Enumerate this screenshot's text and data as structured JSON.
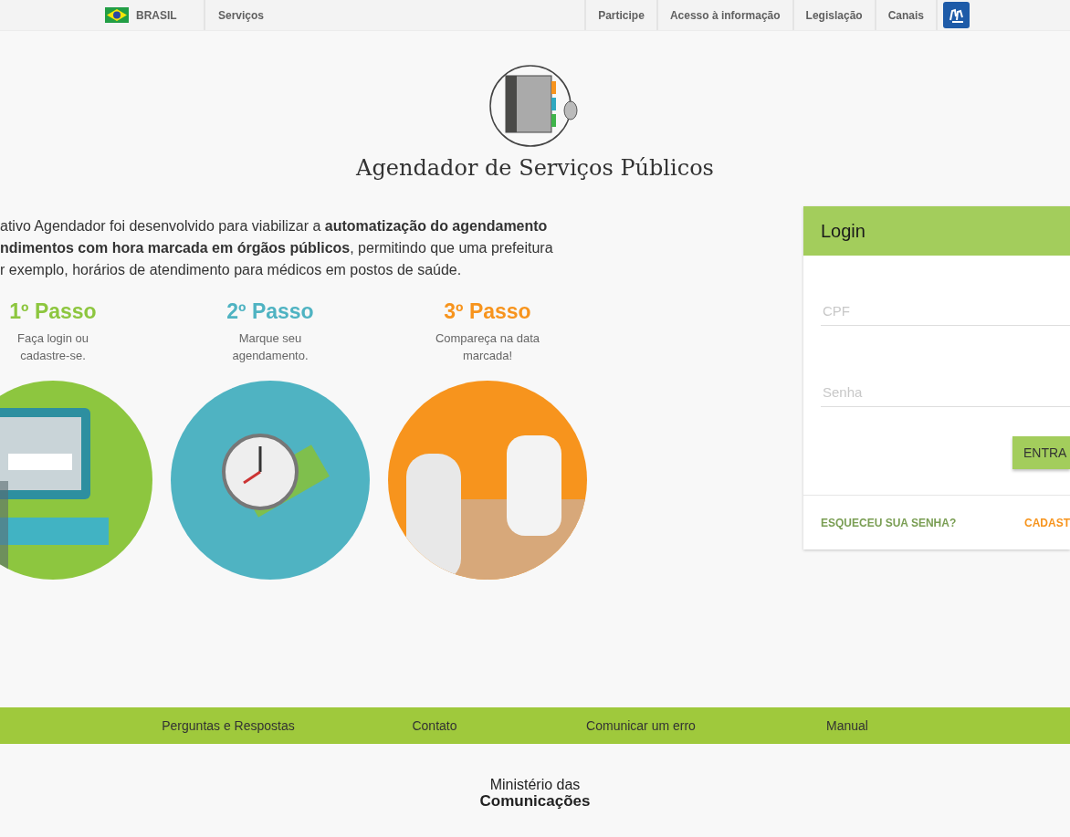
{
  "top_bar": {
    "country": "BRASIL",
    "services": "Serviços",
    "links": [
      "Participe",
      "Acesso à informação",
      "Legislação",
      "Canais"
    ]
  },
  "title": "Agendador de Serviços Públicos",
  "intro_lines": [
    "ativo Agendador foi desenvolvido para viabilizar a **automatização do agendamento**",
    "**ndimentos com hora marcada em órgãos públicos**, permitindo que uma prefeitura",
    "r exemplo, horários de atendimento para médicos em postos de saúde."
  ],
  "steps": [
    {
      "title": "1º Passo",
      "text": "Faça login ou cadastre-se.",
      "color": "#8dc63f",
      "kind": "computer"
    },
    {
      "title": "2º Passo",
      "text": "Marque seu agendamento.",
      "color": "#4fb3c2",
      "kind": "clock"
    },
    {
      "title": "3º Passo",
      "text": "Compareça na data marcada!",
      "color": "#f7941d",
      "kind": "desk"
    }
  ],
  "login": {
    "title": "Login",
    "fields": [
      {
        "placeholder": "CPF"
      },
      {
        "placeholder": "Senha"
      }
    ],
    "button": "ENTRA",
    "forgot_link": "ESQUECEU SUA SENHA?",
    "register_link": "CADAST"
  },
  "footer_links": [
    "Perguntas e Respostas",
    "Contato",
    "Comunicar um erro",
    "Manual"
  ],
  "ministry": {
    "line1": "Ministério das",
    "line2": "Comunicações"
  }
}
